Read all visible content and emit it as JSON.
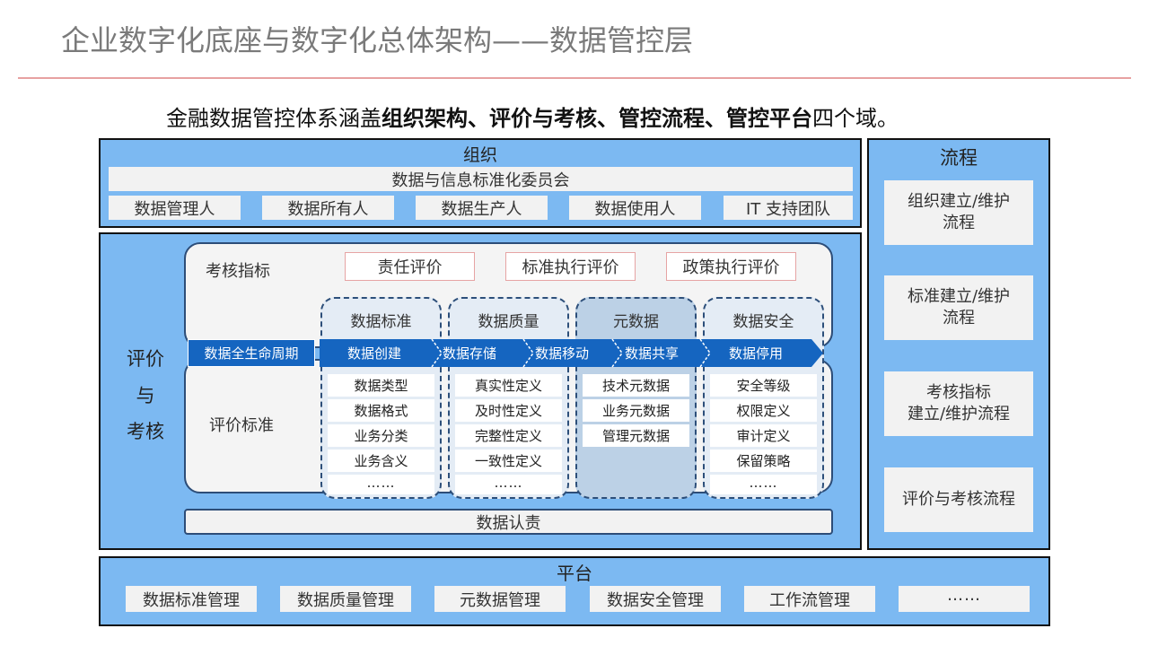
{
  "title": "企业数字化底座与数字化总体架构——数据管控层",
  "subtitle": {
    "prefix": "金融数据管控体系涵盖",
    "bold": "组织架构、评价与考核、管控流程、管控平台",
    "suffix": "四个域。"
  },
  "organization": {
    "title": "组织",
    "committee": "数据与信息标准化委员会",
    "roles": [
      "数据管理人",
      "数据所有人",
      "数据生产人",
      "数据使用人",
      "IT 支持团队"
    ]
  },
  "evaluation": {
    "title_lines": [
      "评价",
      "与",
      "考核"
    ],
    "kpi_label": "考核指标",
    "kpi_items": [
      "责任评价",
      "标准执行评价",
      "政策执行评价"
    ],
    "criteria_label": "评价标准",
    "columns": [
      {
        "head": "数据标准",
        "items": [
          "数据类型",
          "数据格式",
          "业务分类",
          "业务含义",
          "……"
        ]
      },
      {
        "head": "数据质量",
        "items": [
          "真实性定义",
          "及时性定义",
          "完整性定义",
          "一致性定义",
          "……"
        ]
      },
      {
        "head": "元数据",
        "items": [
          "技术元数据",
          "业务元数据",
          "管理元数据"
        ]
      },
      {
        "head": "数据安全",
        "items": [
          "安全等级",
          "权限定义",
          "审计定义",
          "保留策略",
          "……"
        ]
      }
    ],
    "lifecycle_label": "数据全生命周期",
    "lifecycle_steps": [
      "数据创建",
      "数据存储",
      "数据移动",
      "数据共享",
      "数据停用"
    ],
    "accountability": "数据认责"
  },
  "process": {
    "title": "流程",
    "items": [
      [
        "组织建立/维护",
        "流程"
      ],
      [
        "标准建立/维护",
        "流程"
      ],
      [
        "考核指标",
        "建立/维护流程"
      ],
      [
        "评价与考核流程"
      ]
    ]
  },
  "platform": {
    "title": "平台",
    "items": [
      "数据标准管理",
      "数据质量管理",
      "元数据管理",
      "数据安全管理",
      "工作流管理",
      "……"
    ]
  },
  "colors": {
    "panel_blue": "#7cb9f2",
    "lifecycle_blue": "#1565c0",
    "metadata_fill": "#bcd1e6",
    "light_gray": "#f2f2f2"
  }
}
